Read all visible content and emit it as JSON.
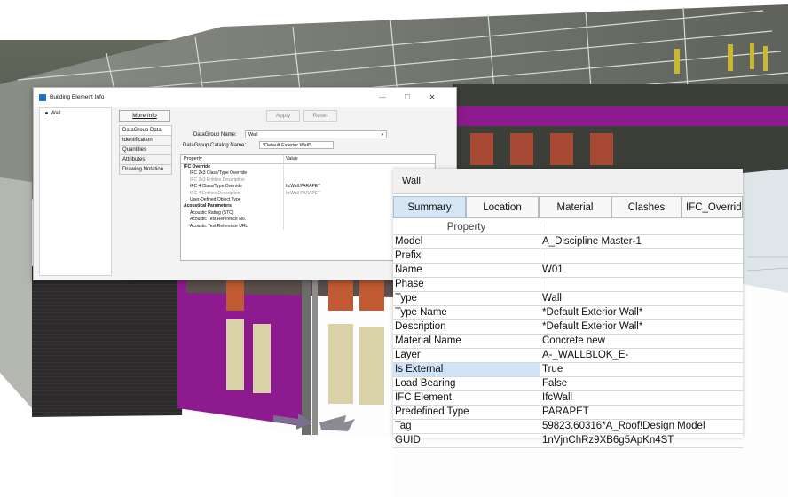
{
  "bei_dialog": {
    "title": "Building Element Info",
    "window_controls": {
      "minimize": "—",
      "maximize": "☐",
      "close": "✕"
    },
    "tree": [
      {
        "label": "Wall"
      }
    ],
    "more_info_label": "More Info",
    "apply_label": "Apply",
    "reset_label": "Reset",
    "tabs": [
      "DataGroup Data",
      "Identification",
      "Quantities",
      "Attributes",
      "Drawing Notation"
    ],
    "datagroup_name_label": "DataGroup Name:",
    "datagroup_name_value": "Wall",
    "catalog_name_label": "DataGroup Catalog Name:",
    "catalog_name_value": "*Default Exterior Wall*",
    "grid_headers": {
      "property": "Property",
      "value": "Value"
    },
    "grid_rows": [
      {
        "property": "IFC Override",
        "value": "",
        "kind": "group"
      },
      {
        "property": "IFC 2x3 Class/Type Override",
        "value": "",
        "kind": "sub"
      },
      {
        "property": "IFC 2x3 Entities Description",
        "value": "",
        "kind": "sub-dim"
      },
      {
        "property": "IFC 4 Class/Type Override",
        "value": "IfcWall.PARAPET",
        "kind": "sub"
      },
      {
        "property": "IFC 4 Entities Description",
        "value": "IfcWall PARAPET",
        "kind": "sub-dim"
      },
      {
        "property": "User-Defined Object Type",
        "value": "",
        "kind": "sub"
      },
      {
        "property": "Acoustical Parameters",
        "value": "",
        "kind": "group"
      },
      {
        "property": "Acoustic Rating (STC)",
        "value": "",
        "kind": "sub"
      },
      {
        "property": "Acoustic Test Reference No.",
        "value": "",
        "kind": "sub"
      },
      {
        "property": "Acoustic Test Reference URL",
        "value": "",
        "kind": "sub"
      }
    ]
  },
  "wall_panel": {
    "title": "Wall",
    "tabs": [
      "Summary",
      "Location",
      "Material",
      "Clashes",
      "IFC_Override"
    ],
    "active_tab": "Summary",
    "property_header": "Property",
    "rows": [
      {
        "property": "Model",
        "value": "A_Discipline Master-1"
      },
      {
        "property": "Prefix",
        "value": ""
      },
      {
        "property": "Name",
        "value": "W01"
      },
      {
        "property": "Phase",
        "value": ""
      },
      {
        "property": "Type",
        "value": "Wall"
      },
      {
        "property": "Type Name",
        "value": "*Default Exterior Wall*"
      },
      {
        "property": "Description",
        "value": "*Default Exterior Wall*"
      },
      {
        "property": "Material Name",
        "value": "Concrete new"
      },
      {
        "property": "Layer",
        "value": "A-_WALLBLOK_E-"
      },
      {
        "property": "Is External",
        "value": "True",
        "selected": true
      },
      {
        "property": "Load Bearing",
        "value": "False"
      },
      {
        "property": "IFC Element",
        "value": "IfcWall"
      },
      {
        "property": "Predefined Type",
        "value": "PARAPET"
      },
      {
        "property": "Tag",
        "value": "59823.60316*A_Roof!Design Model"
      },
      {
        "property": "GUID",
        "value": "1nVjnChRz9XB6g5ApKn4ST"
      }
    ]
  },
  "colors": {
    "accent_magenta": "#8d1a8f",
    "selection_blue": "#cfe4f7",
    "active_tab": "#d6e6f4",
    "window_icon": "#1a73c9"
  }
}
